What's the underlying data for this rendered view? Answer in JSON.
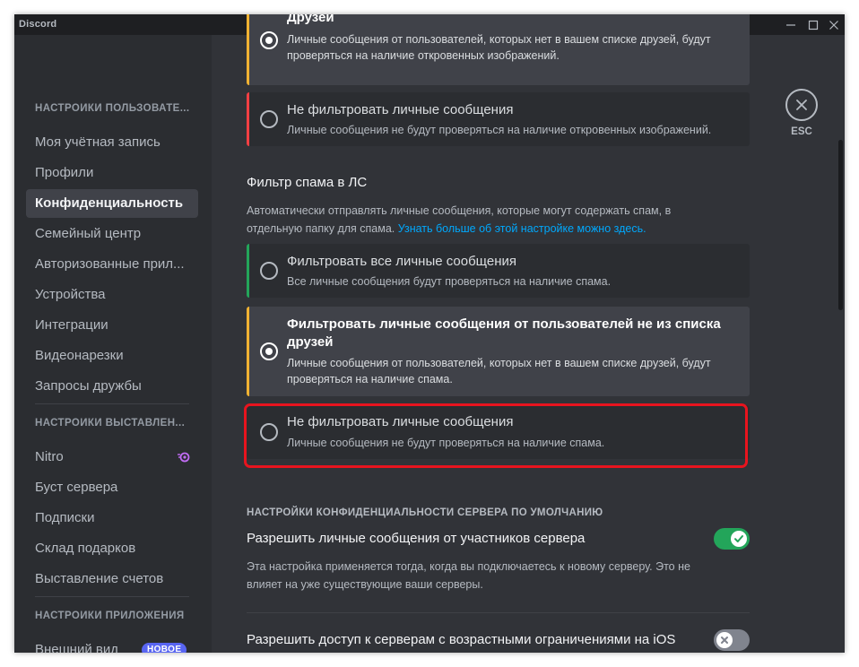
{
  "window": {
    "title": "Discord"
  },
  "sidebar": {
    "sections": [
      {
        "header": "НАСТРОЙКИ ПОЛЬЗОВАТЕ...",
        "items": [
          "Моя учётная запись",
          "Профили",
          "Конфиденциальность",
          "Семейный центр",
          "Авторизованные прил...",
          "Устройства",
          "Интеграции",
          "Видеонарезки",
          "Запросы дружбы"
        ],
        "active": "Конфиденциальность"
      },
      {
        "header": "НАСТРОЙКИ ВЫСТАВЛЕН...",
        "items": [
          "Nitro",
          "Буст сервера",
          "Подписки",
          "Склад подарков",
          "Выставление счетов"
        ]
      },
      {
        "header": "НАСТРОЙКИ ПРИЛОЖЕНИЯ",
        "items": [
          "Внешний вид"
        ],
        "badge": "НОВОЕ"
      }
    ]
  },
  "media_filter": {
    "options": [
      {
        "title": "Друзей",
        "desc": "Личные сообщения от пользователей, которых нет в вашем списке друзей, будут проверяться на наличие откровенных изображений.",
        "selected": true,
        "accent": "#f0b232"
      },
      {
        "title": "Не фильтровать личные сообщения",
        "desc": "Личные сообщения не будут проверяться на наличие откровенных изображений.",
        "selected": false,
        "accent": "#f23f43"
      }
    ]
  },
  "spam_filter": {
    "title": "Фильтр спама в ЛС",
    "description": "Автоматически отправлять личные сообщения, которые могут содержать спам, в отдельную папку для спама.",
    "link": "Узнать больше об этой настройке можно здесь.",
    "options": [
      {
        "title": "Фильтровать все личные сообщения",
        "desc": "Все личные сообщения будут проверяться на наличие спама.",
        "selected": false,
        "accent": "#23a55a"
      },
      {
        "title": "Фильтровать личные сообщения от пользователей не из списка друзей",
        "desc": "Личные сообщения от пользователей, которых нет в вашем списке друзей, будут проверяться на наличие спама.",
        "selected": true,
        "accent": "#f0b232"
      },
      {
        "title": "Не фильтровать личные сообщения",
        "desc": "Личные сообщения не будут проверяться на наличие спама.",
        "selected": false,
        "accent": ""
      }
    ]
  },
  "server_privacy": {
    "header": "НАСТРОЙКИ КОНФИДЕНЦИАЛЬНОСТИ СЕРВЕРА ПО УМОЛЧАНИЮ",
    "settings": [
      {
        "title": "Разрешить личные сообщения от участников сервера",
        "desc": "Эта настройка применяется тогда, когда вы подключаетесь к новому серверу. Это не влияет на уже существующие ваши серверы.",
        "enabled": true
      },
      {
        "title": "Разрешить доступ к серверам с возрастными ограничениями на iOS",
        "desc": "",
        "enabled": false
      }
    ]
  },
  "close": {
    "label": "ESC"
  },
  "colors": {
    "accent_green": "#23a55a",
    "accent_yellow": "#f0b232",
    "accent_red": "#f23f43",
    "highlight": "#e8141e",
    "link": "#00a8fc",
    "badge": "#5865f2"
  }
}
